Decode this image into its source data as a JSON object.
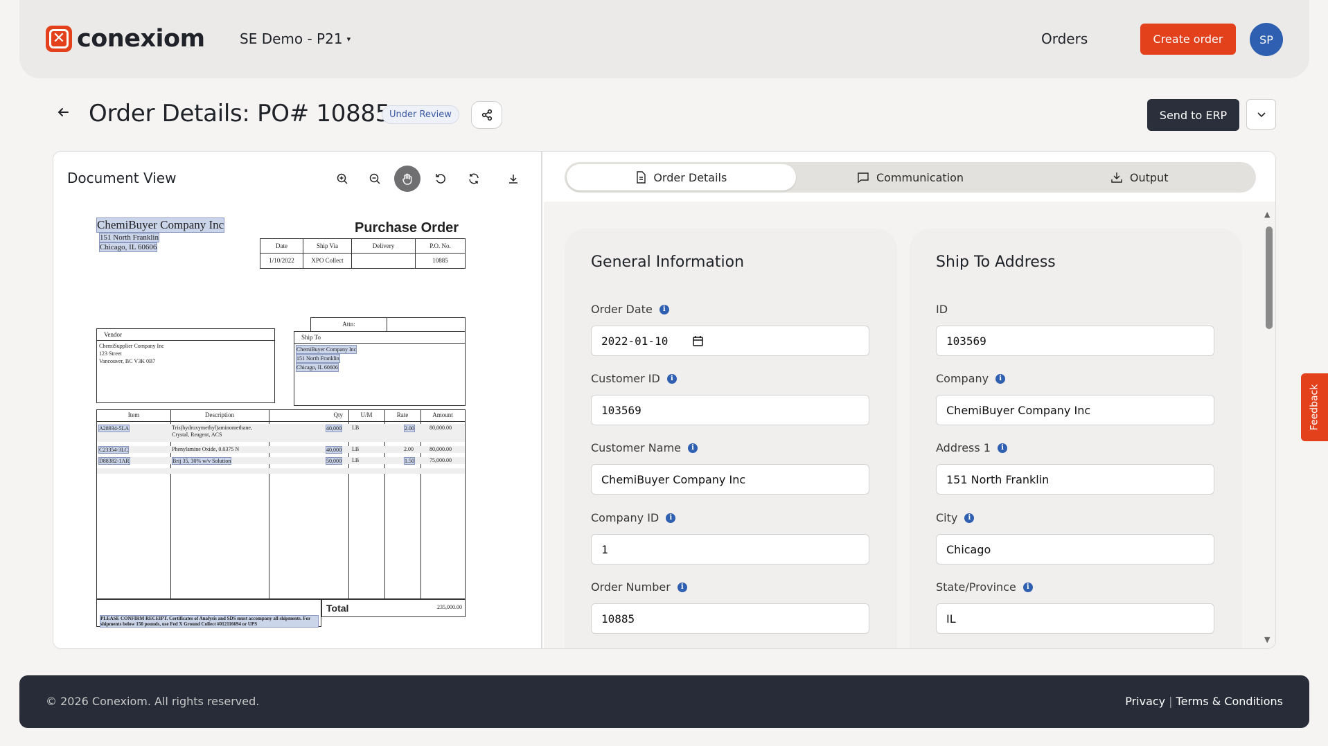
{
  "brand": {
    "logo_text": "conexiom",
    "accent": "#e2411c"
  },
  "header": {
    "workspace": "SE Demo - P21",
    "nav_orders": "Orders",
    "create_order": "Create order",
    "avatar_initials": "SP"
  },
  "page": {
    "title": "Order Details: PO# 10885",
    "status_badge": "Under Review",
    "send_to_erp": "Send to ERP"
  },
  "document_view": {
    "title": "Document View",
    "tools": [
      "zoom-in-icon",
      "zoom-out-icon",
      "hand-pan-icon",
      "rotate-left-icon",
      "refresh-icon",
      "download-icon"
    ],
    "doc": {
      "company": "ChemiBuyer Company Inc",
      "address1": "151 North Franklin",
      "address2": "Chicago, IL 60606",
      "heading": "Purchase Order",
      "hdr_cols": [
        "Date",
        "Ship Via",
        "Delivery",
        "P.O. No."
      ],
      "hdr_vals": [
        "1/10/2022",
        "XPO Collect",
        "",
        "10885"
      ],
      "attn": "Attn:",
      "vendor_label": "Vendor",
      "vendor_lines": [
        "ChemiSupplier Company Inc",
        "123 Street",
        "Vancouver, BC V3K 0B7"
      ],
      "shipto_label": "Ship To",
      "shipto_lines": [
        "ChemiBuyer Company Inc",
        "151 North Franklin",
        "Chicago, IL 60606"
      ],
      "line_cols": [
        "Item",
        "Description",
        "",
        "Qty",
        "U/M",
        "Rate",
        "Amount"
      ],
      "lines": [
        {
          "item": "A28934-5LA",
          "desc": "Tris(hydroxymethyl)aminomethane, Crystal, Reagent, ACS",
          "qty": "40,000",
          "um": "LB",
          "rate": "2.00",
          "amount": "80,000.00"
        },
        {
          "item": "C23354-3LC",
          "desc": "Phenylamine Oxide, 0.0375 N",
          "qty": "40,000",
          "um": "LB",
          "rate": "2.00",
          "amount": "80,000.00"
        },
        {
          "item": "D88382-1AR",
          "desc": "Brij 35, 30% w/v Solution",
          "qty": "50,000",
          "um": "LB",
          "rate": "1.50",
          "amount": "75,000.00"
        }
      ],
      "total_label": "Total",
      "total_value": "235,000.00",
      "note": "PLEASE CONFIRM RECEIPT.  Certificates of Analysis and SDS must accompany all shipments.  For shipments below 150 pounds, use Fed X Ground Collect  #012116694 or UPS"
    }
  },
  "tabs": [
    {
      "label": "Order Details",
      "icon": "document-icon",
      "active": true
    },
    {
      "label": "Communication",
      "icon": "chat-icon",
      "active": false
    },
    {
      "label": "Output",
      "icon": "download-icon",
      "active": false
    }
  ],
  "general_info": {
    "title": "General Information",
    "fields": [
      {
        "label": "Order Date",
        "value": "2022-01-10"
      },
      {
        "label": "Customer ID",
        "value": "103569"
      },
      {
        "label": "Customer Name",
        "value": "ChemiBuyer Company Inc"
      },
      {
        "label": "Company ID",
        "value": "1"
      },
      {
        "label": "Order Number",
        "value": "10885"
      }
    ]
  },
  "ship_to": {
    "title": "Ship To Address",
    "fields": [
      {
        "label": "ID",
        "value": "103569"
      },
      {
        "label": "Company",
        "value": "ChemiBuyer Company Inc"
      },
      {
        "label": "Address 1",
        "value": "151 North Franklin"
      },
      {
        "label": "City",
        "value": "Chicago"
      },
      {
        "label": "State/Province",
        "value": "IL"
      }
    ]
  },
  "feedback": "Feedback",
  "footer": {
    "copyright": "© 2026 Conexiom. All rights reserved.",
    "privacy": "Privacy",
    "separator": "|",
    "terms": "Terms & Conditions"
  }
}
